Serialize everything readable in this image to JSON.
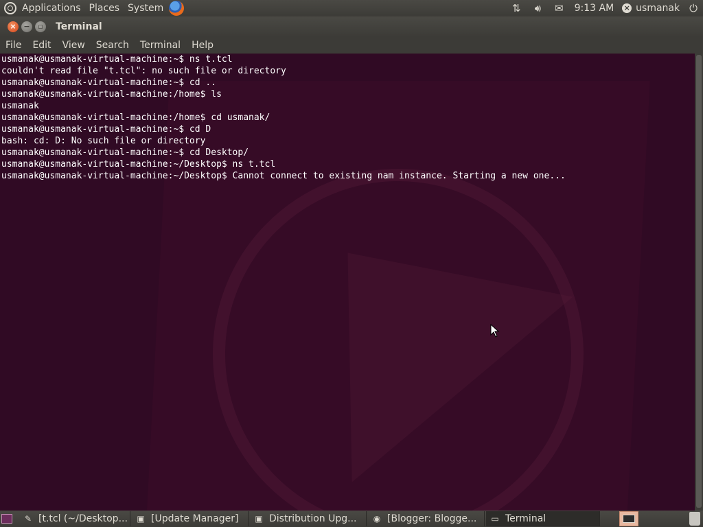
{
  "top_panel": {
    "menus": [
      "Applications",
      "Places",
      "System"
    ],
    "clock": "9:13 AM",
    "user": "usmanak",
    "icons": [
      "ubuntu-logo-icon",
      "firefox-icon",
      "network-icon",
      "volume-icon",
      "mail-icon",
      "user-icon",
      "power-icon"
    ]
  },
  "window": {
    "title": "Terminal",
    "menus": [
      "File",
      "Edit",
      "View",
      "Search",
      "Terminal",
      "Help"
    ]
  },
  "terminal": {
    "lines": [
      "usmanak@usmanak-virtual-machine:~$ ns t.tcl",
      "couldn't read file \"t.tcl\": no such file or directory",
      "usmanak@usmanak-virtual-machine:~$ cd ..",
      "usmanak@usmanak-virtual-machine:/home$ ls",
      "usmanak",
      "usmanak@usmanak-virtual-machine:/home$ cd usmanak/",
      "usmanak@usmanak-virtual-machine:~$ cd D",
      "bash: cd: D: No such file or directory",
      "usmanak@usmanak-virtual-machine:~$ cd Desktop/",
      "usmanak@usmanak-virtual-machine:~/Desktop$ ns t.tcl",
      "usmanak@usmanak-virtual-machine:~/Desktop$ Cannot connect to existing nam instance. Starting a new one..."
    ],
    "background_color": "#300a24"
  },
  "taskbar": {
    "tasks": [
      {
        "label": "[t.tcl (~/Desktop...",
        "icon": "text-editor-icon"
      },
      {
        "label": "[Update Manager]",
        "icon": "package-icon"
      },
      {
        "label": "Distribution Upg...",
        "icon": "package-icon"
      },
      {
        "label": "[Blogger: Blogge...",
        "icon": "chrome-icon"
      },
      {
        "label": "Terminal",
        "icon": "terminal-icon"
      }
    ]
  }
}
